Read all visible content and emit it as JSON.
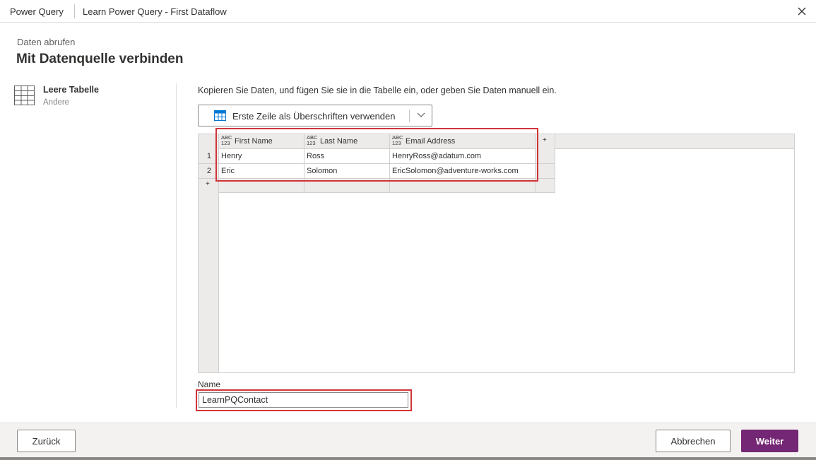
{
  "titlebar": {
    "app_name": "Power Query",
    "document_name": "Learn Power Query - First Dataflow",
    "close_icon": "close-icon"
  },
  "header": {
    "breadcrumb": "Daten abrufen",
    "title": "Mit Datenquelle verbinden"
  },
  "source": {
    "name": "Leere Tabelle",
    "category": "Andere",
    "icon": "table-icon"
  },
  "main": {
    "instructions": "Kopieren Sie Daten, und fügen Sie sie in die Tabelle ein, oder geben Sie Daten manuell ein.",
    "first_row_headers_label": "Erste Zeile als Überschriften verwenden"
  },
  "table": {
    "type_label_top": "ABC",
    "type_label_bottom": "123",
    "add_symbol": "+",
    "columns": [
      "First Name",
      "Last Name",
      "Email Address"
    ],
    "rows": [
      {
        "num": "1",
        "cells": [
          "Henry",
          "Ross",
          "HenryRoss@adatum.com"
        ]
      },
      {
        "num": "2",
        "cells": [
          "Eric",
          "Solomon",
          "EricSolomon@adventure-works.com"
        ]
      }
    ]
  },
  "name_field": {
    "label": "Name",
    "value": "LearnPQContact"
  },
  "footer": {
    "back_label": "Zurück",
    "cancel_label": "Abbrechen",
    "next_label": "Weiter"
  },
  "colors": {
    "accent": "#742774",
    "highlight": "#d13438"
  }
}
